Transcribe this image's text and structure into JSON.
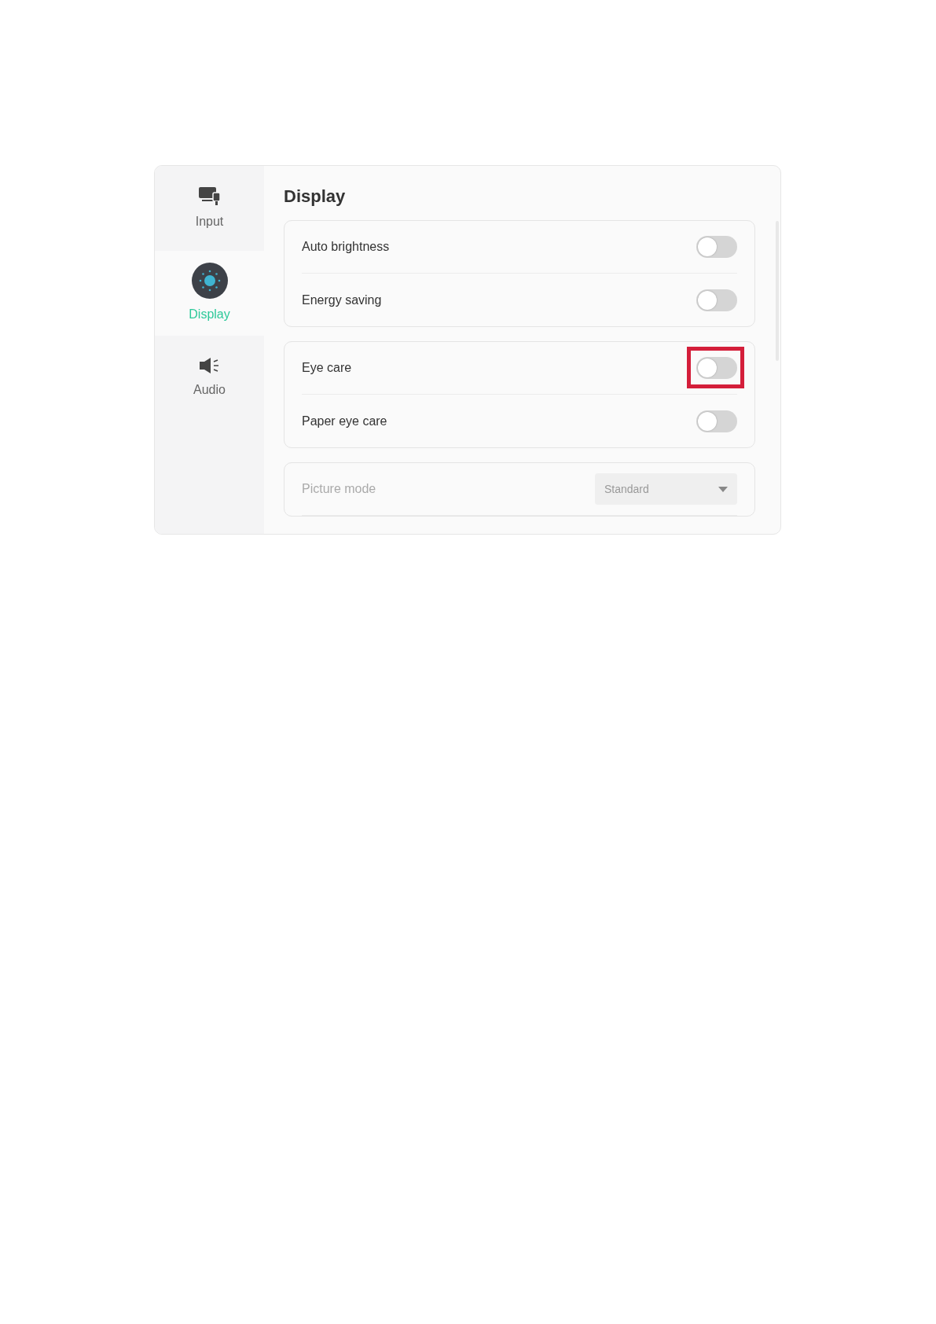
{
  "sidebar": {
    "items": [
      {
        "label": "Input",
        "kind": "input",
        "selected": false
      },
      {
        "label": "Display",
        "kind": "display",
        "selected": true
      },
      {
        "label": "Audio",
        "kind": "audio",
        "selected": false
      }
    ]
  },
  "title": "Display",
  "groups": [
    {
      "rows": [
        {
          "kind": "toggle",
          "label": "Auto brightness",
          "on": false,
          "highlighted": false
        },
        {
          "kind": "toggle",
          "label": "Energy saving",
          "on": false,
          "highlighted": false
        }
      ]
    },
    {
      "rows": [
        {
          "kind": "toggle",
          "label": "Eye care",
          "on": false,
          "highlighted": true
        },
        {
          "kind": "toggle",
          "label": "Paper eye care",
          "on": false,
          "highlighted": false
        }
      ]
    },
    {
      "rows": [
        {
          "kind": "select",
          "label": "Picture mode",
          "value": "Standard",
          "disabled": true
        }
      ]
    }
  ]
}
